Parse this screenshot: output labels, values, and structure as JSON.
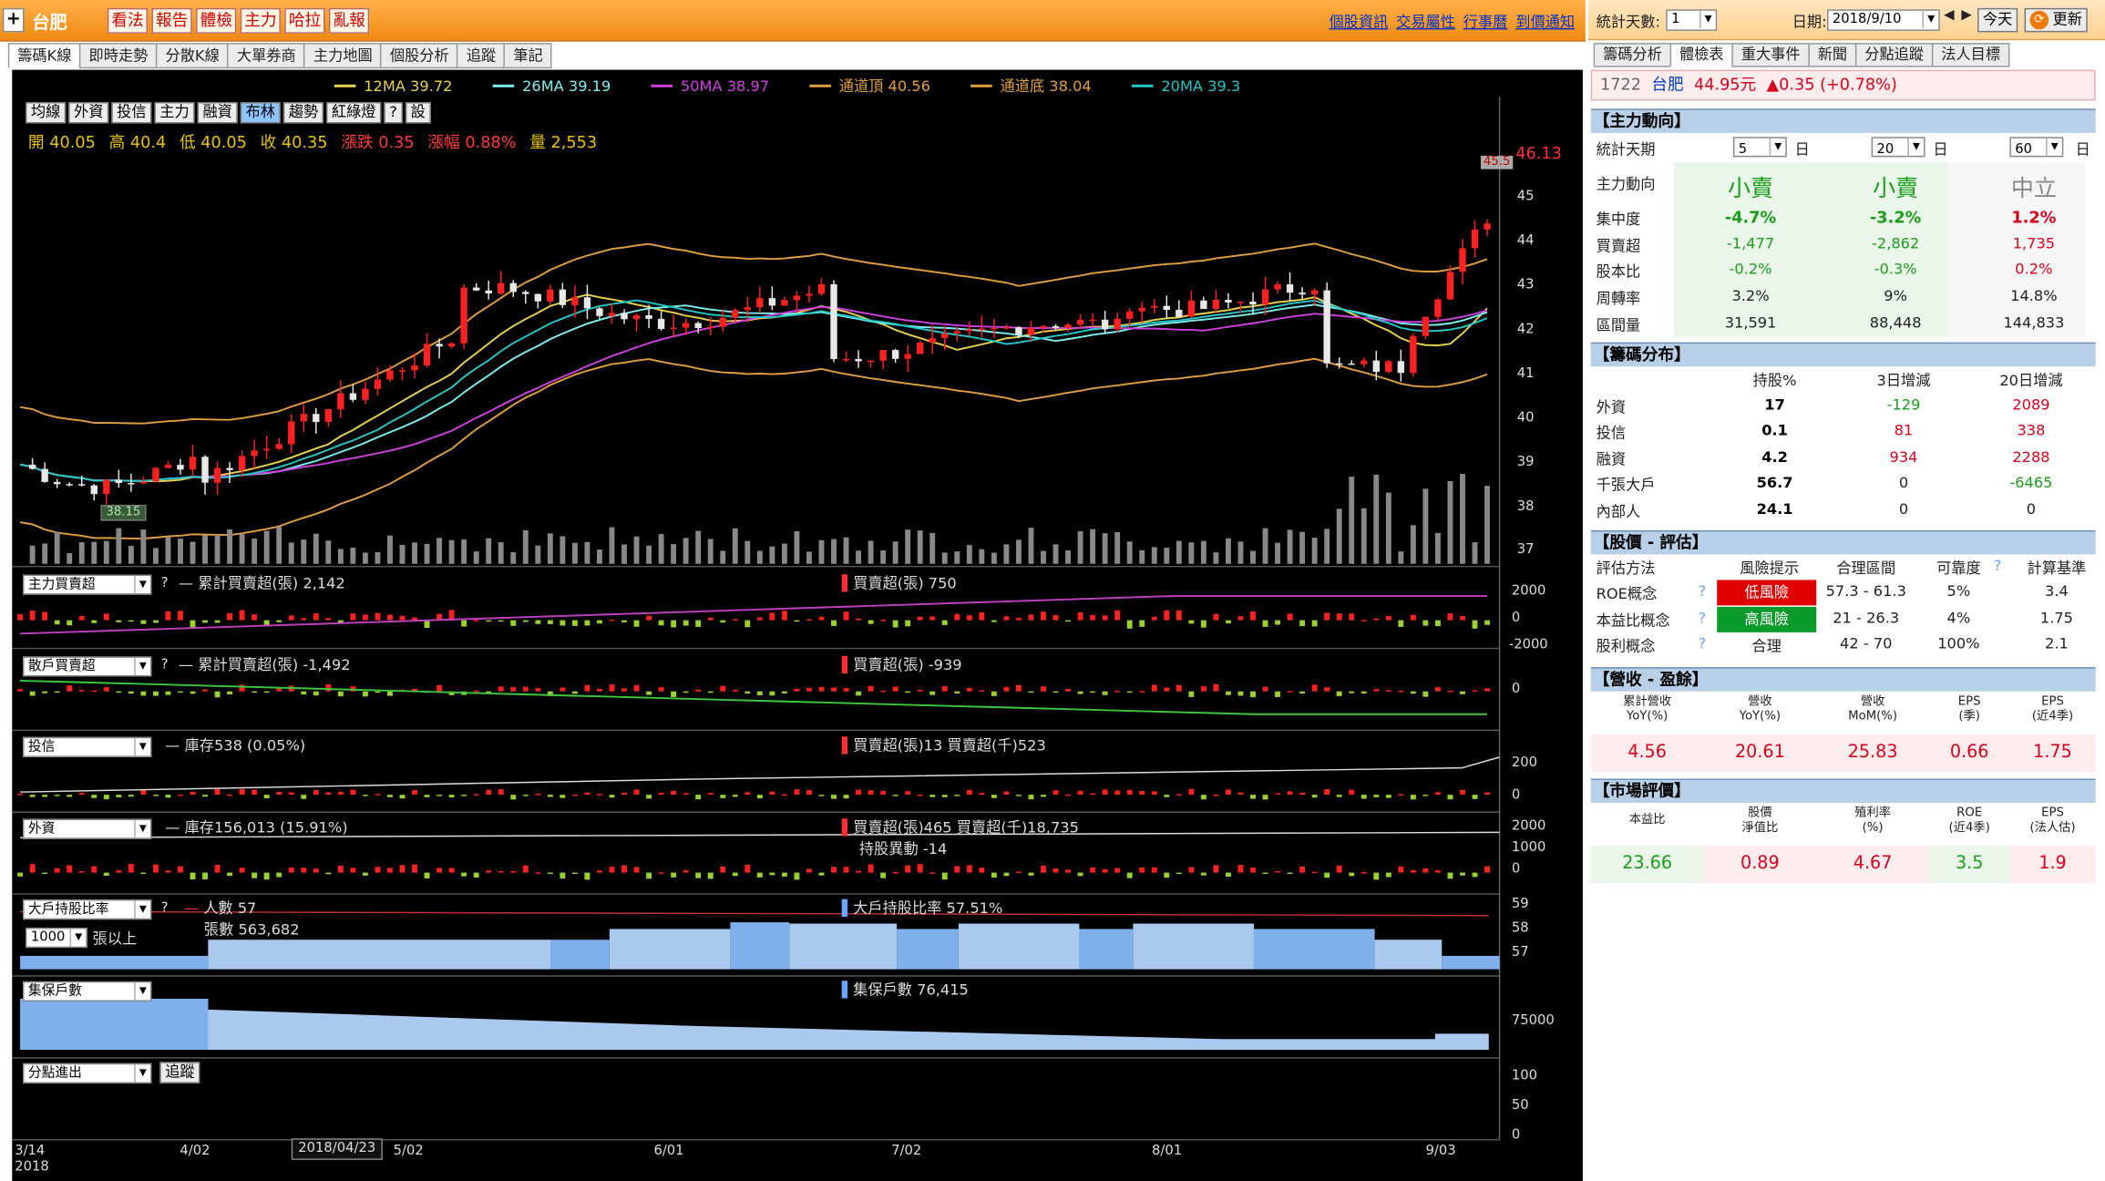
{
  "app": {
    "stock_name": "台肥",
    "top_buttons": [
      "看法",
      "報告",
      "體檢",
      "主力",
      "哈拉",
      "亂報"
    ],
    "top_links": [
      "個股資訊",
      "交易屬性",
      "行事曆",
      "到價通知"
    ],
    "tabs": [
      "籌碼K線",
      "即時走勢",
      "分散K線",
      "大單券商",
      "主力地圖",
      "個股分析",
      "追蹤",
      "筆記"
    ]
  },
  "chart": {
    "ma_legend": [
      {
        "label": "12MA 39.72",
        "color": "#e8d44d"
      },
      {
        "label": "26MA 39.19",
        "color": "#7ef0f0"
      },
      {
        "label": "50MA 38.97",
        "color": "#d040e0"
      },
      {
        "label": "通道頂 40.56",
        "color": "#e0a040"
      },
      {
        "label": "通道底 38.04",
        "color": "#e0a040"
      },
      {
        "label": "20MA 39.3",
        "color": "#22c8c8"
      }
    ],
    "toolbar": [
      "均線",
      "外資",
      "投信",
      "主力",
      "融資",
      "布林",
      "趨勢",
      "紅綠燈",
      "?",
      "設"
    ],
    "ohlc": {
      "open": "開 40.05",
      "high": "高 40.4",
      "low": "低 40.05",
      "close": "收 40.35",
      "change": "漲跌 0.35",
      "pct": "漲幅 0.88%",
      "vol": "量 2,553"
    },
    "price_axis": [
      "46.13",
      "45",
      "44",
      "43",
      "42",
      "41",
      "40",
      "39",
      "38",
      "37"
    ],
    "high_marker": "45.5",
    "low_marker": "38.15",
    "panels": {
      "p1": {
        "select": "主力買賣超",
        "q": "?",
        "left": "累計買賣超(張) 2,142",
        "right": "買賣超(張) 750",
        "axis": [
          "2000",
          "0",
          "-2000"
        ]
      },
      "p2": {
        "select": "散戶買賣超",
        "q": "?",
        "left": "累計買賣超(張) -1,492",
        "right": "買賣超(張) -939",
        "axis": [
          "0"
        ]
      },
      "p3": {
        "select": "投信",
        "left": "庫存538 (0.05%)",
        "right": "買賣超(張)13 買賣超(千)523",
        "axis": [
          "200",
          "0"
        ]
      },
      "p4": {
        "select": "外資",
        "left": "庫存156,013 (15.91%)",
        "right": "買賣超(張)465 買賣超(千)18,735",
        "right2": "持股異動 -14",
        "axis": [
          "2000",
          "1000",
          "0"
        ]
      },
      "p5": {
        "select": "大戶持股比率",
        "q": "?",
        "sub_select": "1000",
        "sub_label": "張以上",
        "left": "人數 57",
        "left2": "張數 563,682",
        "right": "大戶持股比率 57.51%",
        "axis": [
          "59",
          "58",
          "57"
        ]
      },
      "p6": {
        "select": "集保戶數",
        "right": "集保戶數 76,415",
        "axis": [
          "75000"
        ]
      },
      "p7": {
        "select": "分點進出",
        "button": "追蹤",
        "axis": [
          "100",
          "50",
          "0"
        ]
      }
    },
    "x_axis": [
      "3/14",
      "4/02",
      "5/02",
      "6/01",
      "7/02",
      "8/01",
      "9/03"
    ],
    "x_year": "2018",
    "date_box": "2018/04/23"
  },
  "right": {
    "stat_days_label": "統計天數:",
    "stat_days_value": "1",
    "date_label": "日期:",
    "date_value": "2018/9/10",
    "today_btn": "今天",
    "update_btn": "更新",
    "tabs": [
      "籌碼分析",
      "體檢表",
      "重大事件",
      "新聞",
      "分點追蹤",
      "法人目標"
    ],
    "header": {
      "code": "1722",
      "name": "台肥",
      "price": "44.95元",
      "change": "▲0.35 (+0.78%)"
    },
    "s1": {
      "title": "【主力動向】",
      "period_label": "統計天期",
      "periods": [
        "5",
        "20",
        "60"
      ],
      "unit": "日",
      "rows": [
        {
          "label": "主力動向",
          "v": [
            "小賣",
            "小賣",
            "中立"
          ]
        },
        {
          "label": "集中度",
          "v": [
            "-4.7%",
            "-3.2%",
            "1.2%"
          ]
        },
        {
          "label": "買賣超",
          "v": [
            "-1,477",
            "-2,862",
            "1,735"
          ]
        },
        {
          "label": "股本比",
          "v": [
            "-0.2%",
            "-0.3%",
            "0.2%"
          ]
        },
        {
          "label": "周轉率",
          "v": [
            "3.2%",
            "9%",
            "14.8%"
          ]
        },
        {
          "label": "區間量",
          "v": [
            "31,591",
            "88,448",
            "144,833"
          ]
        }
      ]
    },
    "s2": {
      "title": "【籌碼分布】",
      "headers": [
        "持股%",
        "3日增減",
        "20日增減"
      ],
      "rows": [
        {
          "label": "外資",
          "v": [
            "17",
            "-129",
            "2089"
          ]
        },
        {
          "label": "投信",
          "v": [
            "0.1",
            "81",
            "338"
          ]
        },
        {
          "label": "融資",
          "v": [
            "4.2",
            "934",
            "2288"
          ]
        },
        {
          "label": "千張大戶",
          "v": [
            "56.7",
            "0",
            "-6465"
          ]
        },
        {
          "label": "內部人",
          "v": [
            "24.1",
            "0",
            "0"
          ]
        }
      ]
    },
    "s3": {
      "title": "【股價 - 評估】",
      "headers": [
        "評估方法",
        "風險提示",
        "合理區間",
        "可靠度",
        "?",
        "計算基準"
      ],
      "rows": [
        {
          "label": "ROE概念",
          "q": "?",
          "risk": "低風險",
          "range": "57.3 - 61.3",
          "rel": "5%",
          "base": "3.4"
        },
        {
          "label": "本益比概念",
          "q": "?",
          "risk": "高風險",
          "range": "21 - 26.3",
          "rel": "4%",
          "base": "1.75"
        },
        {
          "label": "股利概念",
          "q": "?",
          "risk": "合理",
          "range": "42 - 70",
          "rel": "100%",
          "base": "2.1"
        }
      ]
    },
    "s4": {
      "title": "【營收 - 盈餘】",
      "headers": [
        [
          "累計營收",
          "YoY(%)"
        ],
        [
          "營收",
          "YoY(%)"
        ],
        [
          "營收",
          "MoM(%)"
        ],
        [
          "EPS",
          "(季)"
        ],
        [
          "EPS",
          "(近4季)"
        ]
      ],
      "values": [
        "4.56",
        "20.61",
        "25.83",
        "0.66",
        "1.75"
      ]
    },
    "s5": {
      "title": "【市場評價】",
      "headers": [
        [
          "本益比",
          ""
        ],
        [
          "股價",
          "淨值比"
        ],
        [
          "殖利率",
          "(%)"
        ],
        [
          "ROE",
          "(近4季)"
        ],
        [
          "EPS",
          "(法人估)"
        ]
      ],
      "values": [
        "23.66",
        "0.89",
        "4.67",
        "3.5",
        "1.9"
      ]
    }
  },
  "colors": {
    "up": "#ff2020",
    "down": "#e8e8e8",
    "accent": "#f08a12"
  }
}
